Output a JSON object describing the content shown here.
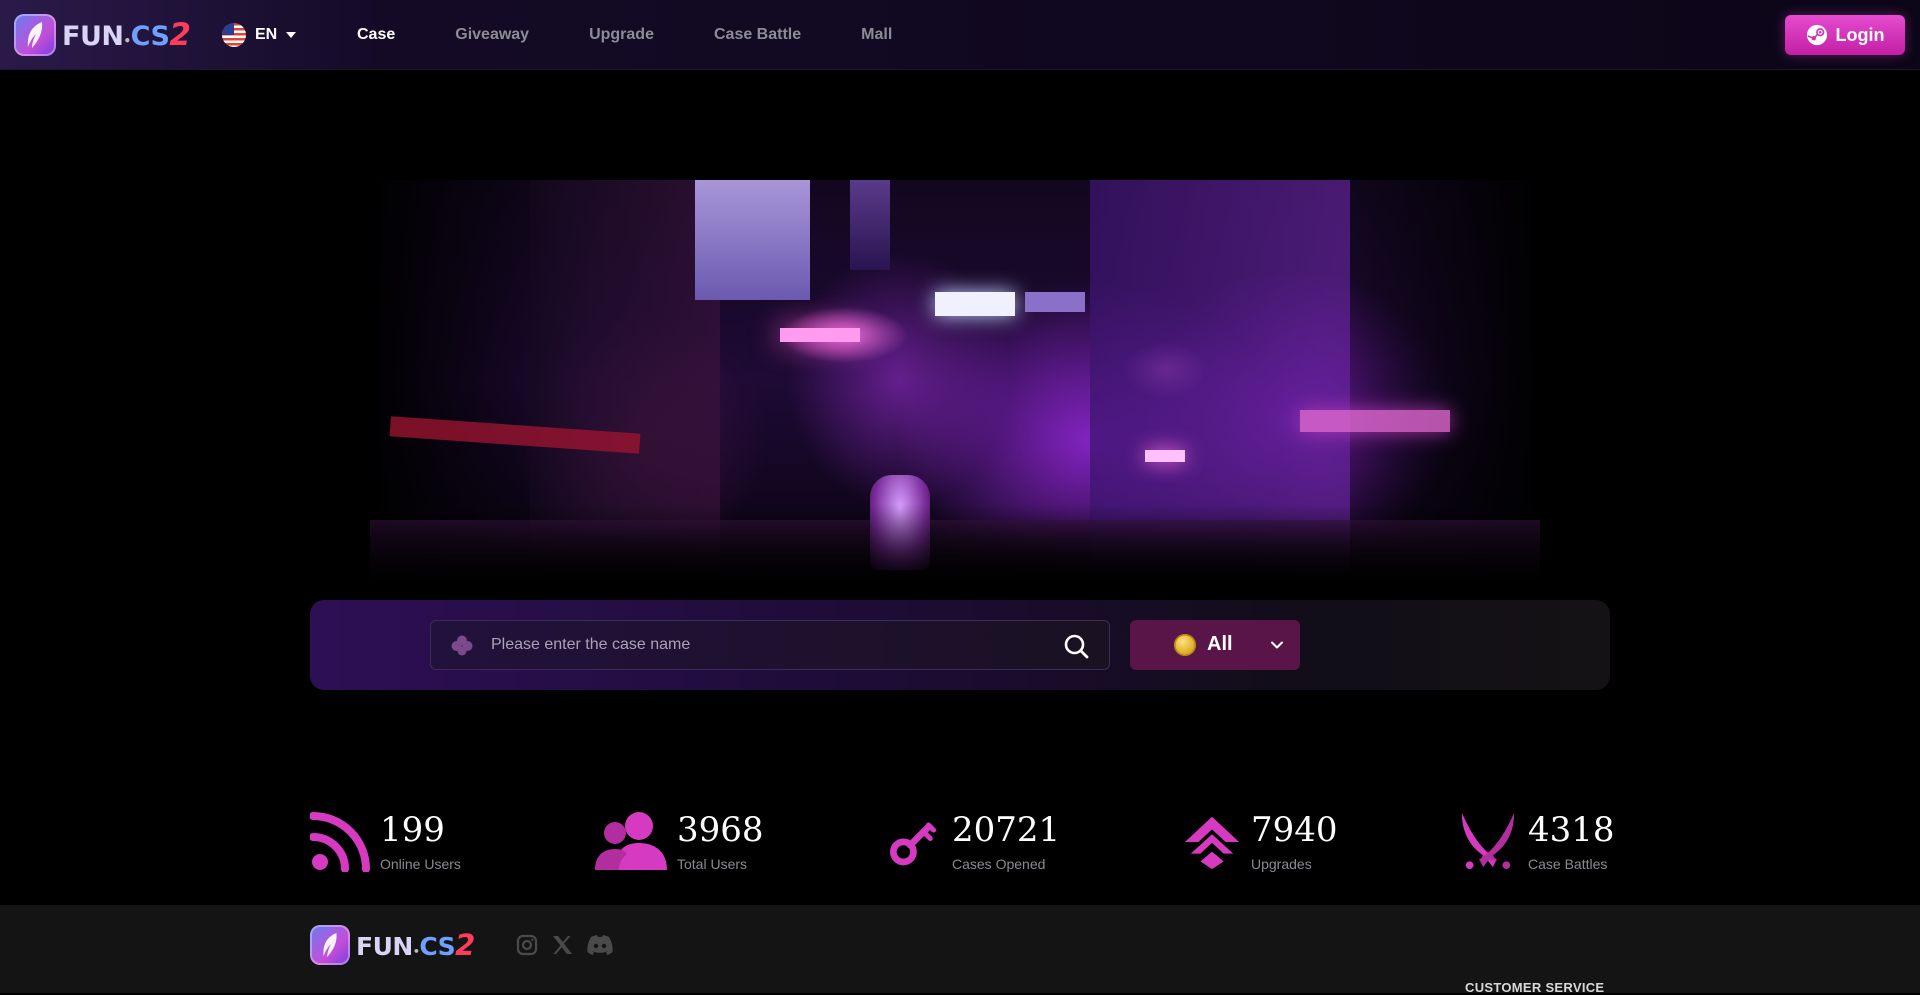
{
  "header": {
    "logo": {
      "text_fun": "FUN",
      "text_cs": "CS",
      "text_two": "2"
    },
    "language": {
      "code": "EN"
    },
    "nav": [
      {
        "label": "Case",
        "active": true
      },
      {
        "label": "Giveaway",
        "active": false
      },
      {
        "label": "Upgrade",
        "active": false
      },
      {
        "label": "Case Battle",
        "active": false
      },
      {
        "label": "Mall",
        "active": false
      }
    ],
    "login_label": "Login"
  },
  "search": {
    "placeholder": "Please enter the case name",
    "filter_label": "All"
  },
  "stats": [
    {
      "value": "199",
      "label": "Online Users",
      "icon": "rss-icon"
    },
    {
      "value": "3968",
      "label": "Total Users",
      "icon": "users-icon"
    },
    {
      "value": "20721",
      "label": "Cases Opened",
      "icon": "key-icon"
    },
    {
      "value": "7940",
      "label": "Upgrades",
      "icon": "upgrade-arrow-icon"
    },
    {
      "value": "4318",
      "label": "Case Battles",
      "icon": "crossed-swords-icon"
    }
  ],
  "footer": {
    "logo": {
      "text_fun": "FUN",
      "text_cs": "CS",
      "text_two": "2"
    },
    "social": [
      "instagram-icon",
      "x-icon",
      "discord-icon"
    ],
    "customer_service_heading": "CUSTOMER SERVICE"
  },
  "colors": {
    "accent": "#d63ac0",
    "login_button": "#d93cc2",
    "filter_button": "#5a1548",
    "stat_icon": "#d63ac0"
  }
}
